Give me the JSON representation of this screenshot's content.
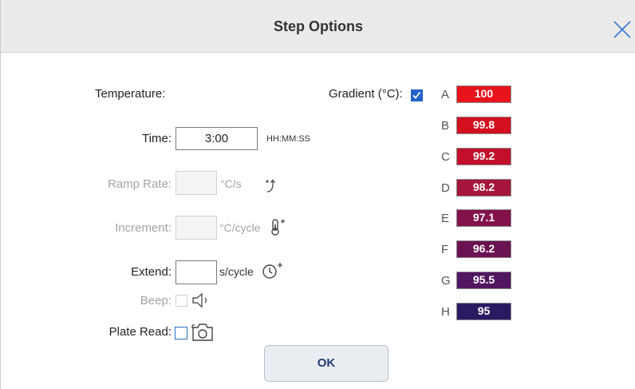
{
  "dialog": {
    "title": "Step Options",
    "close_icon": "close-icon"
  },
  "fields": {
    "temperature_label": "Temperature:",
    "time_label": "Time:",
    "time_value": "3:00",
    "time_unit": "HH:MM:SS",
    "ramp_label": "Ramp Rate:",
    "ramp_value": "",
    "ramp_unit": "°C/s",
    "increment_label": "Increment:",
    "increment_value": "",
    "increment_unit": "°C/cycle",
    "extend_label": "Extend:",
    "extend_value": "",
    "extend_unit": "s/cycle",
    "beep_label": "Beep:",
    "plate_read_label": "Plate Read:",
    "gradient_label": "Gradient (°C):",
    "gradient_checked": true
  },
  "gradient_wells": [
    {
      "row": "A",
      "value": "100",
      "color": "#e8141c"
    },
    {
      "row": "B",
      "value": "99.8",
      "color": "#d21020"
    },
    {
      "row": "C",
      "value": "99.2",
      "color": "#c10f2c"
    },
    {
      "row": "D",
      "value": "98.2",
      "color": "#a6153c"
    },
    {
      "row": "E",
      "value": "97.1",
      "color": "#83114a"
    },
    {
      "row": "F",
      "value": "96.2",
      "color": "#6b1253"
    },
    {
      "row": "G",
      "value": "95.5",
      "color": "#511660"
    },
    {
      "row": "H",
      "value": "95",
      "color": "#2b1a62"
    }
  ],
  "buttons": {
    "ok_label": "OK"
  },
  "colors": {
    "accent": "#2563c9",
    "title_bar": "#ebebeb",
    "disabled_text": "#a3a3a3"
  }
}
